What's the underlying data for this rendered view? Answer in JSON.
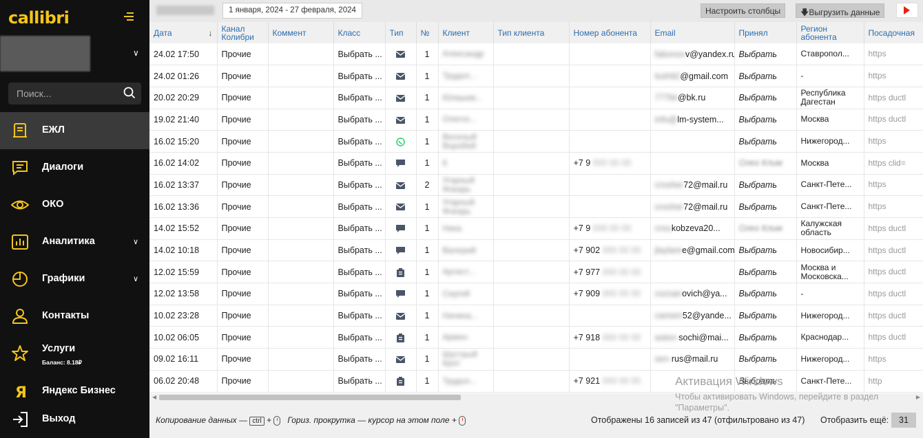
{
  "sidebar": {
    "logo": "callibri",
    "search_placeholder": "Поиск...",
    "items": [
      {
        "label": "ЕЖЛ"
      },
      {
        "label": "Диалоги"
      },
      {
        "label": "ОКО"
      },
      {
        "label": "Аналитика"
      },
      {
        "label": "Графики"
      },
      {
        "label": "Контакты"
      },
      {
        "label": "Услуги",
        "sub": "Баланс: 8.18₽"
      },
      {
        "label": "Яндекс Бизнес"
      },
      {
        "label": "Выход"
      }
    ]
  },
  "toolbar": {
    "date_range": "1 января, 2024 - 27 февраля, 2024",
    "columns_button": "Настроить столбцы",
    "export_button": "Выгрузить данные"
  },
  "table": {
    "headers": [
      "Дата",
      "Канал Колибри",
      "Коммент",
      "Класс",
      "Тип",
      "№",
      "Клиент",
      "Тип клиента",
      "Номер абонента",
      "Email",
      "Принял",
      "Регион абонента",
      "Посадочная"
    ],
    "rows": [
      {
        "date": "24.02 17:50",
        "channel": "Прочие",
        "class": "Выбрать ...",
        "type": "mail",
        "num": "1",
        "client": "Александр",
        "phone": "",
        "email_blur": "fabonov",
        "email": "v@yandex.ru",
        "accepted": "Выбрать",
        "region": "Ставропол...",
        "landing": "https"
      },
      {
        "date": "24.02 01:26",
        "channel": "Прочие",
        "class": "Выбрать ...",
        "type": "mail",
        "num": "1",
        "client": "Трудол...",
        "phone": "",
        "email_blur": "losh92",
        "email": "@gmail.com",
        "accepted": "Выбрать",
        "region": "-",
        "landing": "https"
      },
      {
        "date": "20.02 20:29",
        "channel": "Прочие",
        "class": "Выбрать ...",
        "type": "mail",
        "num": "1",
        "client": "Юлашев...",
        "phone": "",
        "email_blur": "777kk",
        "email": "@bk.ru",
        "accepted": "Выбрать",
        "region": "Республика Дагестан",
        "landing": "https ductl"
      },
      {
        "date": "19.02 21:40",
        "channel": "Прочие",
        "class": "Выбрать ...",
        "type": "mail",
        "num": "1",
        "client": "Олегоз...",
        "phone": "",
        "email_blur": "info@",
        "email": "lm-system...",
        "accepted": "Выбрать",
        "region": "Москва",
        "landing": "https ductl"
      },
      {
        "date": "16.02 15:20",
        "channel": "Прочие",
        "class": "Выбрать ...",
        "type": "whatsapp",
        "num": "1",
        "client": "Веселый Воробей",
        "phone": "",
        "email_blur": "",
        "email": "",
        "accepted": "Выбрать",
        "region": "Нижегород...",
        "landing": "https"
      },
      {
        "date": "16.02 14:02",
        "channel": "Прочие",
        "class": "Выбрать ...",
        "type": "chat",
        "num": "1",
        "client": "К",
        "phone": "+7 9",
        "email_blur": "",
        "email": "",
        "accepted": "Олег Клим",
        "region": "Москва",
        "landing": "https clid="
      },
      {
        "date": "16.02 13:37",
        "channel": "Прочие",
        "class": "Выбрать ...",
        "type": "mail",
        "num": "2",
        "client": "Угарный Фокарь",
        "phone": "",
        "email_blur": "crosher",
        "email": "72@mail.ru",
        "accepted": "Выбрать",
        "region": "Санкт-Пете...",
        "landing": "https"
      },
      {
        "date": "16.02 13:36",
        "channel": "Прочие",
        "class": "Выбрать ...",
        "type": "mail",
        "num": "1",
        "client": "Угарный Фокарь",
        "phone": "",
        "email_blur": "crosher",
        "email": "72@mail.ru",
        "accepted": "Выбрать",
        "region": "Санкт-Пете...",
        "landing": "https"
      },
      {
        "date": "14.02 15:52",
        "channel": "Прочие",
        "class": "Выбрать ...",
        "type": "chat",
        "num": "1",
        "client": "Ника",
        "phone": "+7 9",
        "email_blur": "crou",
        "email": "kobzeva20...",
        "accepted": "Олег Клим",
        "region": "Калужская область",
        "landing": "https ductl"
      },
      {
        "date": "14.02 10:18",
        "channel": "Прочие",
        "class": "Выбрать ...",
        "type": "chat",
        "num": "1",
        "client": "Валерий",
        "phone": "+7 902",
        "email_blur": "jlaylare",
        "email": "e@gmail.com",
        "accepted": "Выбрать",
        "region": "Новосибир...",
        "landing": "https ductl"
      },
      {
        "date": "12.02 15:59",
        "channel": "Прочие",
        "class": "Выбрать ...",
        "type": "clipboard",
        "num": "1",
        "client": "Артист...",
        "phone": "+7 977",
        "email_blur": "",
        "email": "",
        "accepted": "Выбрать",
        "region": "Москва и Московска...",
        "landing": "https ductl"
      },
      {
        "date": "12.02 13:58",
        "channel": "Прочие",
        "class": "Выбрать ...",
        "type": "chat",
        "num": "1",
        "client": "Сергей",
        "phone": "+7 909",
        "email_blur": "cozsan",
        "email": "ovich@ya...",
        "accepted": "Выбрать",
        "region": "-",
        "landing": "https ductl"
      },
      {
        "date": "10.02 23:28",
        "channel": "Прочие",
        "class": "Выбрать ...",
        "type": "mail",
        "num": "1",
        "client": "Начина...",
        "phone": "",
        "email_blur": "cansen",
        "email": "52@yande...",
        "accepted": "Выбрать",
        "region": "Нижегород...",
        "landing": "https ductl"
      },
      {
        "date": "10.02 06:05",
        "channel": "Прочие",
        "class": "Выбрать ...",
        "type": "clipboard",
        "num": "1",
        "client": "Армен",
        "phone": "+7 918",
        "email_blur": "aston-",
        "email": "sochi@mai...",
        "accepted": "Выбрать",
        "region": "Краснодар...",
        "landing": "https ductl"
      },
      {
        "date": "09.02 16:11",
        "channel": "Прочие",
        "class": "Выбрать ...",
        "type": "mail",
        "num": "1",
        "client": "Шустрый Крот",
        "phone": "",
        "email_blur": "sen-",
        "email": "rus@mail.ru",
        "accepted": "Выбрать",
        "region": "Нижегород...",
        "landing": "https"
      },
      {
        "date": "06.02 20:48",
        "channel": "Прочие",
        "class": "Выбрать ...",
        "type": "clipboard",
        "num": "1",
        "client": "Трудол...",
        "phone": "+7 921",
        "email_blur": "",
        "email": "",
        "accepted": "Выбрать",
        "region": "Санкт-Пете...",
        "landing": "http"
      }
    ]
  },
  "footer": {
    "copy_hint": "Копирование данных —",
    "ctrl": "ctrl",
    "scroll_hint": "Гориз. прокрутка — курсор на этом поле +",
    "status": "Отображены 16 записей из 47 (отфильтровано из 47)",
    "show_more": "Отобразить ещё:",
    "more_count": "31"
  },
  "watermark": {
    "title": "Активация Windows",
    "text": "Чтобы активировать Windows, перейдите в раздел \"Параметры\"."
  },
  "colors": {
    "accent": "#f5c518",
    "sidebar_bg": "#111111",
    "link": "#2b6cb0"
  }
}
